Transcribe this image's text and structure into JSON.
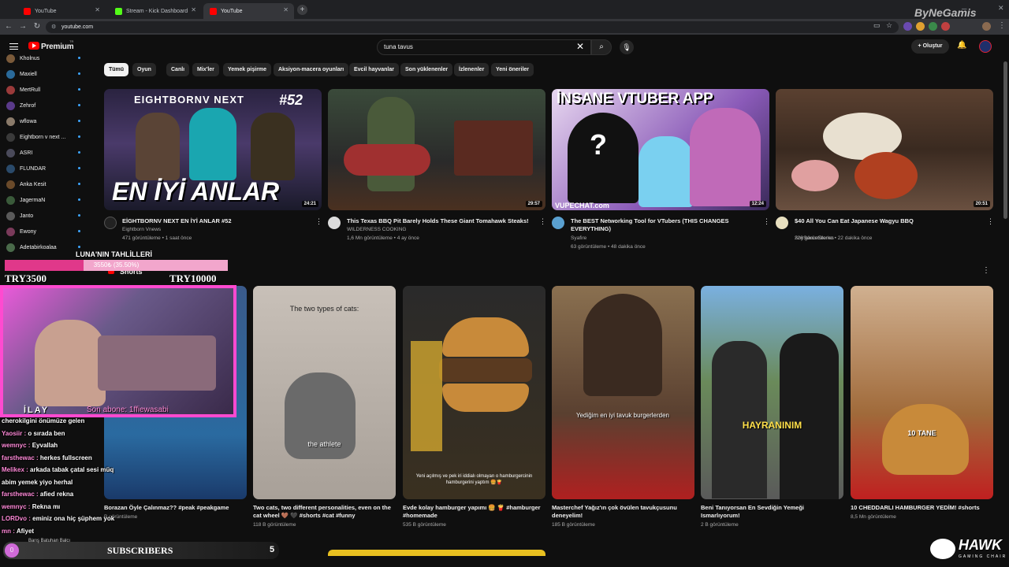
{
  "browser": {
    "tabs": [
      {
        "label": "YouTube",
        "color": "#ff0000",
        "active": false
      },
      {
        "label": "Stream - Kick Dashboard",
        "color": "#53fc18",
        "active": false
      },
      {
        "label": "YouTube",
        "color": "#ff0000",
        "active": true
      }
    ],
    "url": "youtube.com",
    "new_tab": "+"
  },
  "header": {
    "brand": "Premium",
    "brand_sup": "TR",
    "search_value": "tuna tavus",
    "create_label": "Oluştur"
  },
  "chips": [
    "Tümü",
    "Oyun",
    "Canlı",
    "Mix'ler",
    "Yemek pişirme",
    "Aksiyon-macera oyunları",
    "Evcil hayvanlar",
    "Son yüklenenler",
    "İzlenenler",
    "Yeni öneriler"
  ],
  "sidebar": {
    "subscriptions": [
      {
        "name": "Kholnus",
        "color": "#7a5a3a"
      },
      {
        "name": "Maxiell",
        "color": "#2a6a9a"
      },
      {
        "name": "MertRull",
        "color": "#9a3a3a"
      },
      {
        "name": "Zehrof",
        "color": "#5a3a8a"
      },
      {
        "name": "wflowa",
        "color": "#8a7a6a"
      },
      {
        "name": "Eightborn v next ...",
        "color": "#3a3a3a"
      },
      {
        "name": "ASRI",
        "color": "#4a4a5a"
      },
      {
        "name": "FLUNDAR",
        "color": "#2a4a6a"
      },
      {
        "name": "Anka Kesit",
        "color": "#6a4a2a"
      },
      {
        "name": "JagermaN",
        "color": "#3a5a3a"
      },
      {
        "name": "Janto",
        "color": "#5a5a5a"
      },
      {
        "name": "Ewony",
        "color": "#7a3a5a"
      },
      {
        "name": "Adetabirkoalaa",
        "color": "#4a6a4a"
      }
    ],
    "shorts_label": "Shorts"
  },
  "videos": [
    {
      "title": "EİGHTBORNV NEXT EN İYİ ANLAR #52",
      "channel": "Eightborn Vnews",
      "meta": "471 görüntüleme • 1 saat önce",
      "duration": "24:21",
      "thumb_text": "EN İYİ ANLAR",
      "thumb_top": "EIGHTBORNV NEXT",
      "thumb_tag": "#52"
    },
    {
      "title": "This Texas BBQ Pit Barely Holds These Giant Tomahawk Steaks!",
      "channel": "WILDERNESS COOKING",
      "meta": "1,6 Mn görüntüleme • 4 ay önce",
      "duration": "29:57"
    },
    {
      "title": "The BEST Networking Tool for VTubers (THIS CHANGES EVERYTHING)",
      "channel": "Syafire",
      "meta": "63 görüntüleme • 48 dakika önce",
      "duration": "12:24",
      "thumb_text": "İNSANE VTUBER APP",
      "thumb_brand": "VUPECHAT.com"
    },
    {
      "title": "$40 All You Can Eat Japanese Wagyu BBQ",
      "channel": "SoySauceStories",
      "meta": "228 görüntüleme • 22 dakika önce",
      "duration": "20:51"
    }
  ],
  "shorts": [
    {
      "title": "Borazan Öyle Çalınmaz?? #peak #peakgame",
      "meta": "B görüntüleme"
    },
    {
      "title": "Two cats, two different personalities, even on the cat wheel 🤎 🖤 #shorts #cat #funny",
      "meta": "118 B görüntüleme",
      "cap_top": "The two types of cats:",
      "cap_bottom": "the athlete"
    },
    {
      "title": "Evde kolay hamburger yapımı 🍔 🍟 #hamburger #homemade",
      "meta": "535 B görüntüleme",
      "cap": "Yeni açılmış ve pek iri iddialı olmayan o hamburgercinin hamburgerini yaptım 🍔🍟"
    },
    {
      "title": "Masterchef Yağız'ın çok övülen tavukçusunu deneyelim!",
      "meta": "185 B görüntüleme",
      "cap": "Yediğim en iyi tavuk burgerlerden"
    },
    {
      "title": "Beni Tanıyorsan En Sevdiğin Yemeği Ismarlıyorum!",
      "meta": "2 B görüntüleme",
      "cap": "HAYRANINIM"
    },
    {
      "title": "10 CHEDDARLI HAMBURGER YEDİM! #shorts",
      "meta": "8,5 Mn görüntüleme",
      "cap": "10 TANE"
    }
  ],
  "overlay": {
    "goal_title": "LUNA'NIN TAHLİLLERİ",
    "goal_progress": "3550₺ (35.50%)",
    "goal_progress_fraction": 0.355,
    "goal_start": "TRY3500",
    "goal_end": "TRY10000",
    "streamer_name": "İLAY",
    "last_sub": "Son abone: 1ffiewasabi",
    "watermark_top": "ByNeGamis",
    "watermark_brand": "HAWK",
    "watermark_sub": "GAMING CHAIR",
    "subscribers_label": "SUBSCRIBERS",
    "subscribers_count": "5",
    "subscribers_badge": "0",
    "recent_user": "Barış Batuhan Balcı",
    "chat": [
      {
        "user": "",
        "text": "cherokilgini önümüze gelen"
      },
      {
        "user": "Yaosiir :",
        "text": "o sırada ben"
      },
      {
        "user": "wemnyc :",
        "text": "Eyvallah"
      },
      {
        "user": "farsthewac :",
        "text": "herkes fullscreen"
      },
      {
        "user": "Melikex :",
        "text": "arkada tabak çatal sesi müq"
      },
      {
        "user": "",
        "text": "abim yemek yiyo herhal"
      },
      {
        "user": "farsthewac :",
        "text": "afied rekna"
      },
      {
        "user": "wemnyc :",
        "text": "Rekna mı"
      },
      {
        "user": "LORDvo :",
        "text": "eminiz ona hiç şüphem yok"
      },
      {
        "user": "mn :",
        "text": "Afiyet"
      }
    ]
  }
}
